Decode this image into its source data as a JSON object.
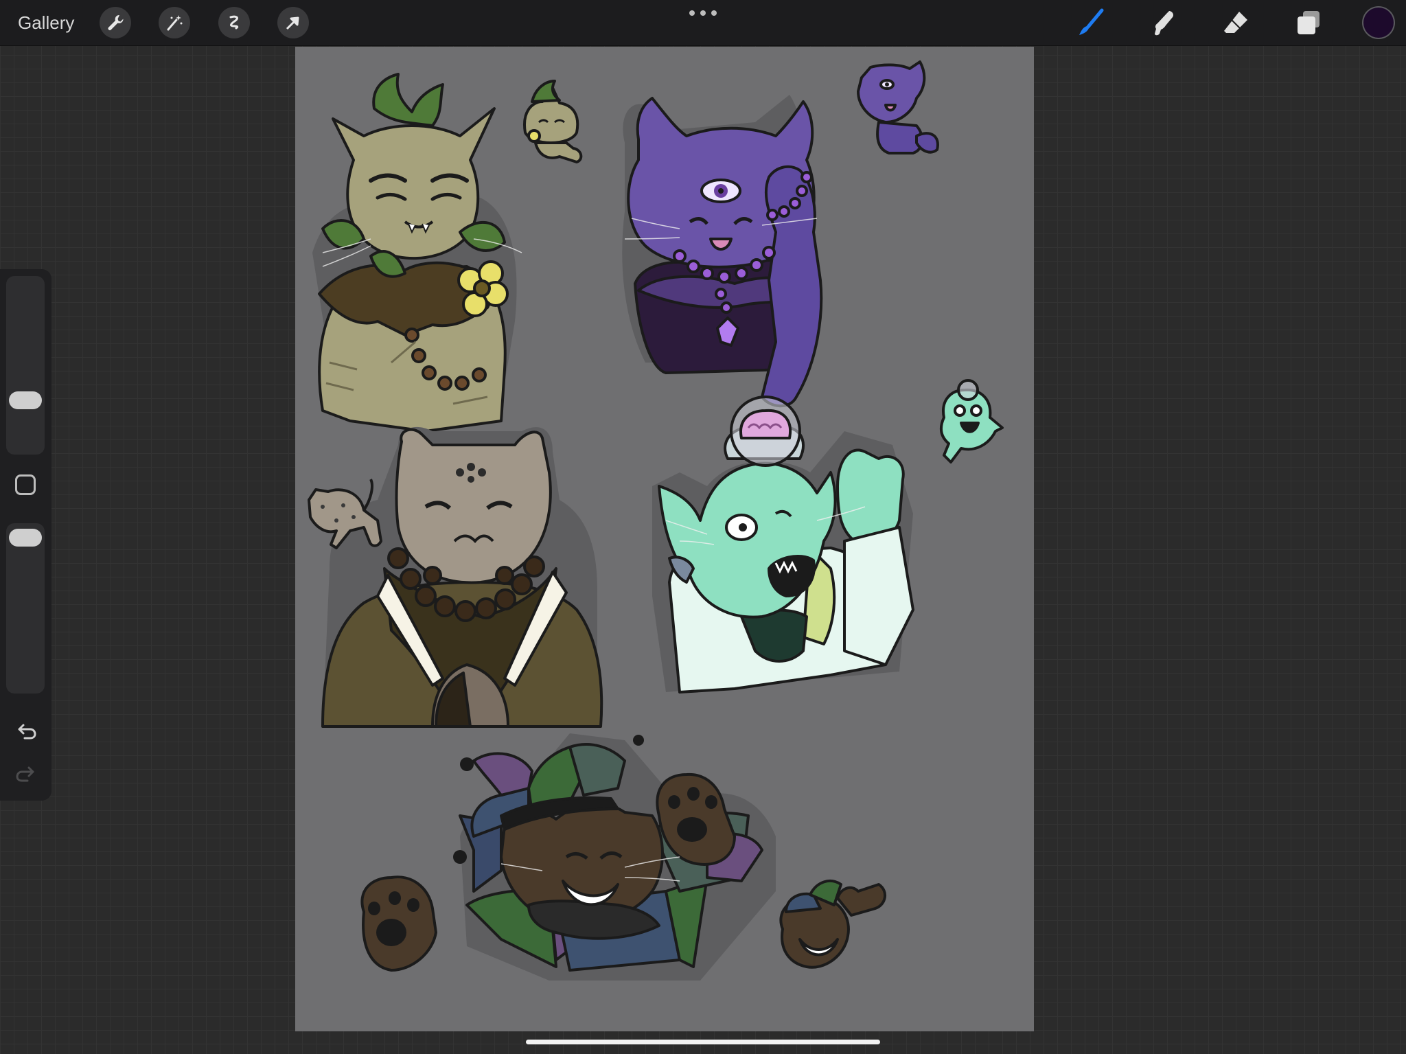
{
  "topbar": {
    "gallery_label": "Gallery",
    "left_tools": [
      "wrench-icon",
      "magic-wand-icon",
      "selection-icon",
      "transform-arrow-icon"
    ],
    "right_tools": [
      "brush-icon",
      "smudge-icon",
      "eraser-icon",
      "layers-icon"
    ],
    "active_tool": "brush",
    "active_tool_color": "#1e7cf2",
    "current_color": "#1d0a2c"
  },
  "sidebar": {
    "tools": [
      "brush-size-slider",
      "modify-button",
      "opacity-slider",
      "undo-icon",
      "redo-icon"
    ]
  },
  "canvas": {
    "background": "#6f6f71",
    "characters": [
      "leaf-cat",
      "purple-eye-cat",
      "monk-cat",
      "scientist-cat",
      "jester-cat"
    ]
  }
}
